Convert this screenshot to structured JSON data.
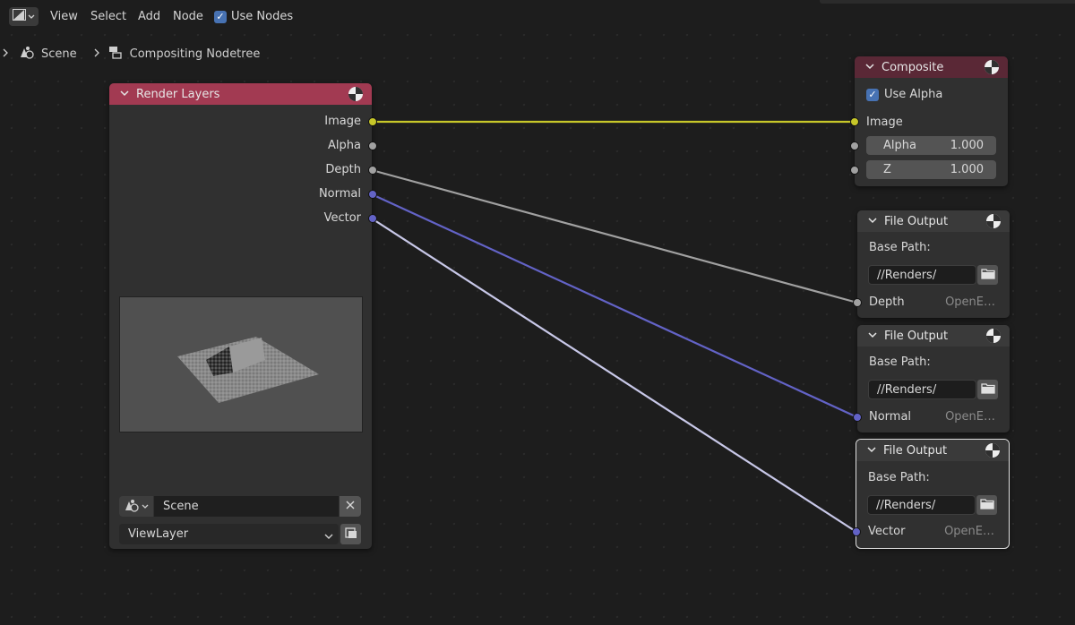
{
  "header": {
    "menu": [
      "View",
      "Select",
      "Add",
      "Node"
    ],
    "use_nodes_label": "Use Nodes",
    "use_nodes_checked": true
  },
  "breadcrumb": {
    "scene": "Scene",
    "nodetree": "Compositing Nodetree"
  },
  "colors": {
    "render_layers_header": "#a23a52",
    "composite_header": "#5a2836",
    "file_output_header": "#3a3a3a",
    "socket_image": "#c7c729",
    "socket_float": "#a1a1a1",
    "socket_vector": "#6363c7",
    "accent": "#4772b3"
  },
  "nodes": {
    "render_layers": {
      "title": "Render Layers",
      "outputs": [
        "Image",
        "Alpha",
        "Depth",
        "Normal",
        "Vector"
      ],
      "scene_value": "Scene",
      "view_layer_value": "ViewLayer"
    },
    "composite": {
      "title": "Composite",
      "use_alpha_label": "Use Alpha",
      "image_label": "Image",
      "alpha_label": "Alpha",
      "alpha_value": "1.000",
      "z_label": "Z",
      "z_value": "1.000"
    },
    "file_outputs": [
      {
        "title": "File Output",
        "base_path_label": "Base Path:",
        "path": "//Renders/",
        "input": "Depth",
        "format": "OpenE…"
      },
      {
        "title": "File Output",
        "base_path_label": "Base Path:",
        "path": "//Renders/",
        "input": "Normal",
        "format": "OpenE…"
      },
      {
        "title": "File Output",
        "base_path_label": "Base Path:",
        "path": "//Renders/",
        "input": "Vector",
        "format": "OpenE…"
      }
    ]
  }
}
